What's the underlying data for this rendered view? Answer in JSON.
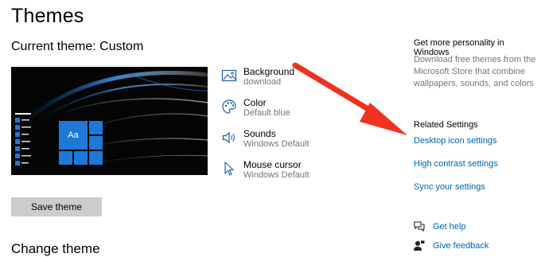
{
  "header": {
    "title": "Themes"
  },
  "current_theme": {
    "label": "Current theme: Custom"
  },
  "preview": {
    "tile_text": "Aa"
  },
  "settings": [
    {
      "title": "Background",
      "subtitle": "download",
      "icon": "picture-icon"
    },
    {
      "title": "Color",
      "subtitle": "Default blue",
      "icon": "palette-icon"
    },
    {
      "title": "Sounds",
      "subtitle": "Windows Default",
      "icon": "speaker-icon"
    },
    {
      "title": "Mouse cursor",
      "subtitle": "Windows Default",
      "icon": "cursor-icon"
    }
  ],
  "actions": {
    "save_label": "Save theme"
  },
  "cutoff_heading": "Change theme",
  "sidebar": {
    "personality_heading": "Get more personality in Windows",
    "personality_desc": "Download free themes from the Microsoft Store that combine wallpapers, sounds, and colors",
    "related_heading": "Related Settings",
    "links": [
      "Desktop icon settings",
      "High contrast settings",
      "Sync your settings"
    ],
    "help": [
      {
        "label": "Get help",
        "icon": "chat-help-icon"
      },
      {
        "label": "Give feedback",
        "icon": "feedback-person-icon"
      }
    ]
  },
  "colors": {
    "accent": "#0063b1",
    "tile_blue": "#1e78d7",
    "annotation_arrow": "#f0321e",
    "button_gray": "#cccccc"
  }
}
